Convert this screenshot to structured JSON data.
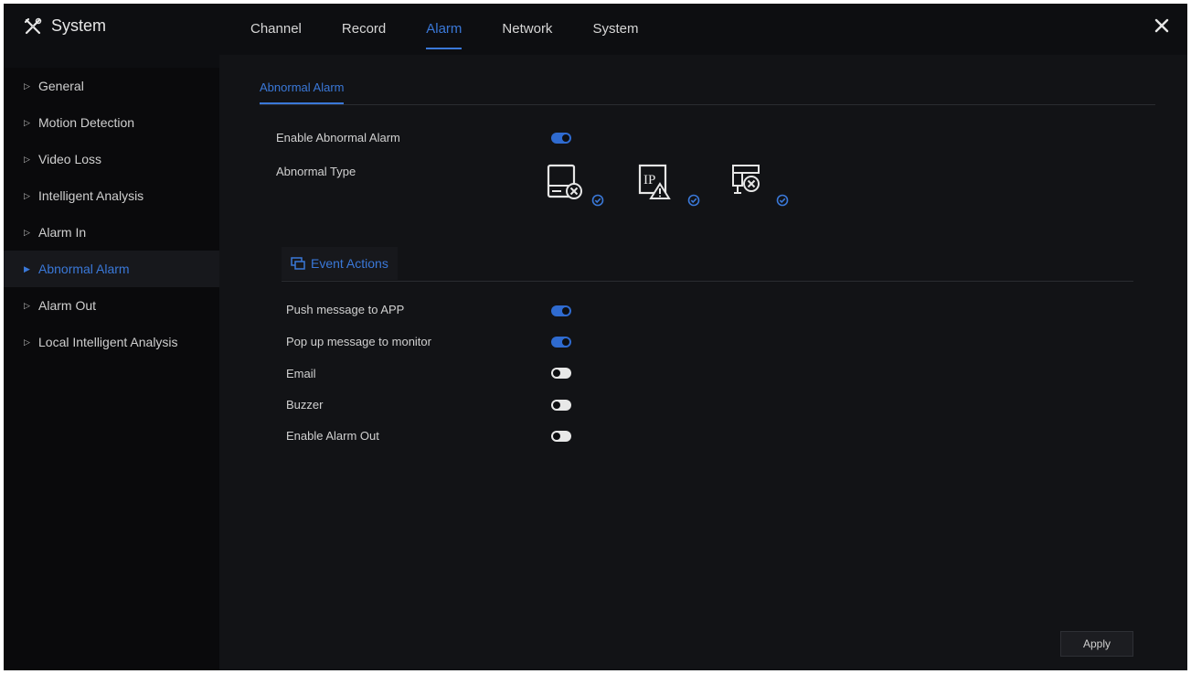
{
  "app": {
    "title": "System",
    "icon": "tools-icon"
  },
  "tabs": [
    {
      "label": "Channel",
      "active": false
    },
    {
      "label": "Record",
      "active": false
    },
    {
      "label": "Alarm",
      "active": true
    },
    {
      "label": "Network",
      "active": false
    },
    {
      "label": "System",
      "active": false
    }
  ],
  "close": {
    "icon": "close-icon"
  },
  "sidebar": {
    "items": [
      {
        "label": "General",
        "active": false
      },
      {
        "label": "Motion Detection",
        "active": false
      },
      {
        "label": "Video Loss",
        "active": false
      },
      {
        "label": "Intelligent Analysis",
        "active": false
      },
      {
        "label": "Alarm In",
        "active": false
      },
      {
        "label": "Abnormal Alarm",
        "active": true
      },
      {
        "label": "Alarm Out",
        "active": false
      },
      {
        "label": "Local Intelligent Analysis",
        "active": false
      }
    ]
  },
  "main": {
    "section_tab": "Abnormal Alarm",
    "enable_label": "Enable Abnormal Alarm",
    "enable_on": true,
    "type_label": "Abnormal Type",
    "types": [
      {
        "icon": "disk-error-icon",
        "checked": true
      },
      {
        "icon": "ip-conflict-icon",
        "checked": true
      },
      {
        "icon": "network-disconnect-icon",
        "checked": true
      }
    ],
    "event_actions": {
      "title": "Event Actions",
      "icon": "event-actions-icon",
      "items": [
        {
          "label": "Push message to APP",
          "on": true
        },
        {
          "label": "Pop up message to monitor",
          "on": true
        },
        {
          "label": "Email",
          "on": false
        },
        {
          "label": "Buzzer",
          "on": false
        },
        {
          "label": "Enable Alarm Out",
          "on": false
        }
      ]
    },
    "apply_label": "Apply"
  },
  "colors": {
    "accent": "#3a78d8",
    "background": "#0d0e11",
    "panel": "#121316"
  }
}
